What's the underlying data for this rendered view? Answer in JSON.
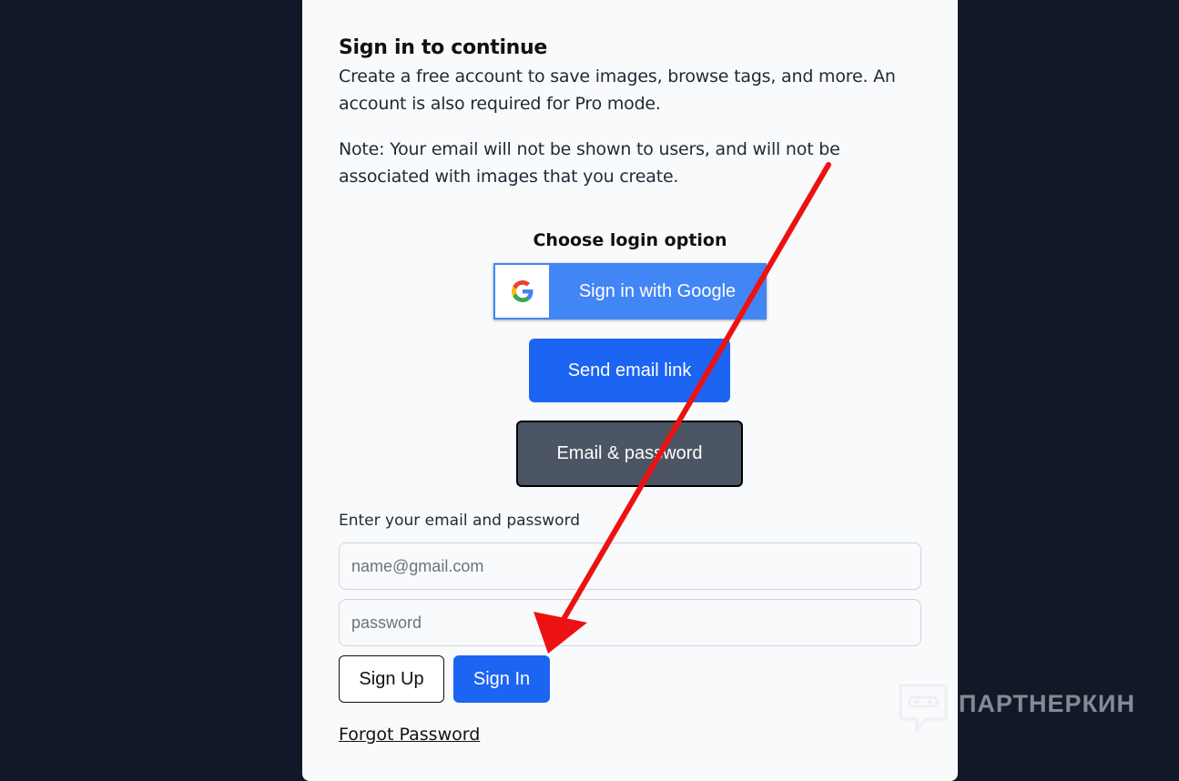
{
  "card": {
    "title": "Sign in to continue",
    "intro": "Create a free account to save images, browse tags, and more. An account is also required for Pro mode.",
    "note": "Note: Your email will not be shown to users, and will not be associated with images that you create."
  },
  "login_options": {
    "heading": "Choose login option",
    "google_label": "Sign in with Google",
    "google_icon": "google-g-icon",
    "email_link_label": "Send email link",
    "email_password_label": "Email & password"
  },
  "form": {
    "label": "Enter your email and password",
    "email_value": "",
    "email_placeholder": "name@gmail.com",
    "password_value": "",
    "password_placeholder": "password",
    "signup_label": "Sign Up",
    "signin_label": "Sign In",
    "forgot_label": "Forgot Password"
  },
  "annotation": {
    "arrow_color": "#ee1111",
    "arrow_target": "Sign In"
  },
  "watermark": {
    "text": "ПАРТНЕРКИН",
    "icon": "chat-bubble-mask-icon"
  },
  "colors": {
    "background": "#111827",
    "card": "#f9fafb",
    "primary": "#1c64f2",
    "google": "#4285f4",
    "secondary": "#4b5563"
  }
}
